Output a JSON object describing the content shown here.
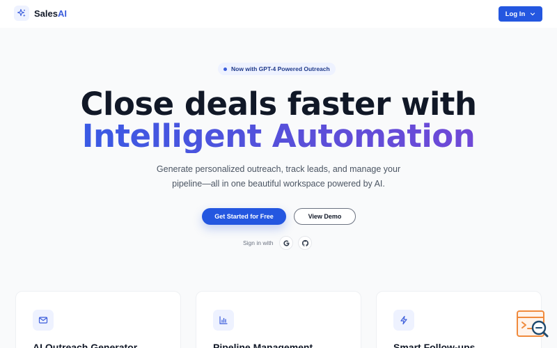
{
  "nav": {
    "brand_prefix": "Sales",
    "brand_suffix": "AI",
    "login_label": "Log In"
  },
  "hero": {
    "badge": "Now with GPT-4 Powered Outreach",
    "title_line1": "Close deals faster with",
    "title_line2": "Intelligent Automation",
    "subtitle_line1": "Generate personalized outreach, track leads, and manage your",
    "subtitle_line2": "pipeline—all in one beautiful workspace powered by AI.",
    "primary_cta": "Get Started for Free",
    "secondary_cta": "View Demo",
    "signin_label": "Sign in with"
  },
  "features": [
    {
      "icon": "mail-icon",
      "title": "AI Outreach Generator"
    },
    {
      "icon": "bar-chart-icon",
      "title": "Pipeline Management"
    },
    {
      "icon": "lightning-icon",
      "title": "Smart Follow-ups"
    }
  ],
  "colors": {
    "accent": "#2457e0",
    "gradient_start": "#2e5ee8",
    "gradient_end": "#7a46d6",
    "background": "#f9fafb"
  }
}
